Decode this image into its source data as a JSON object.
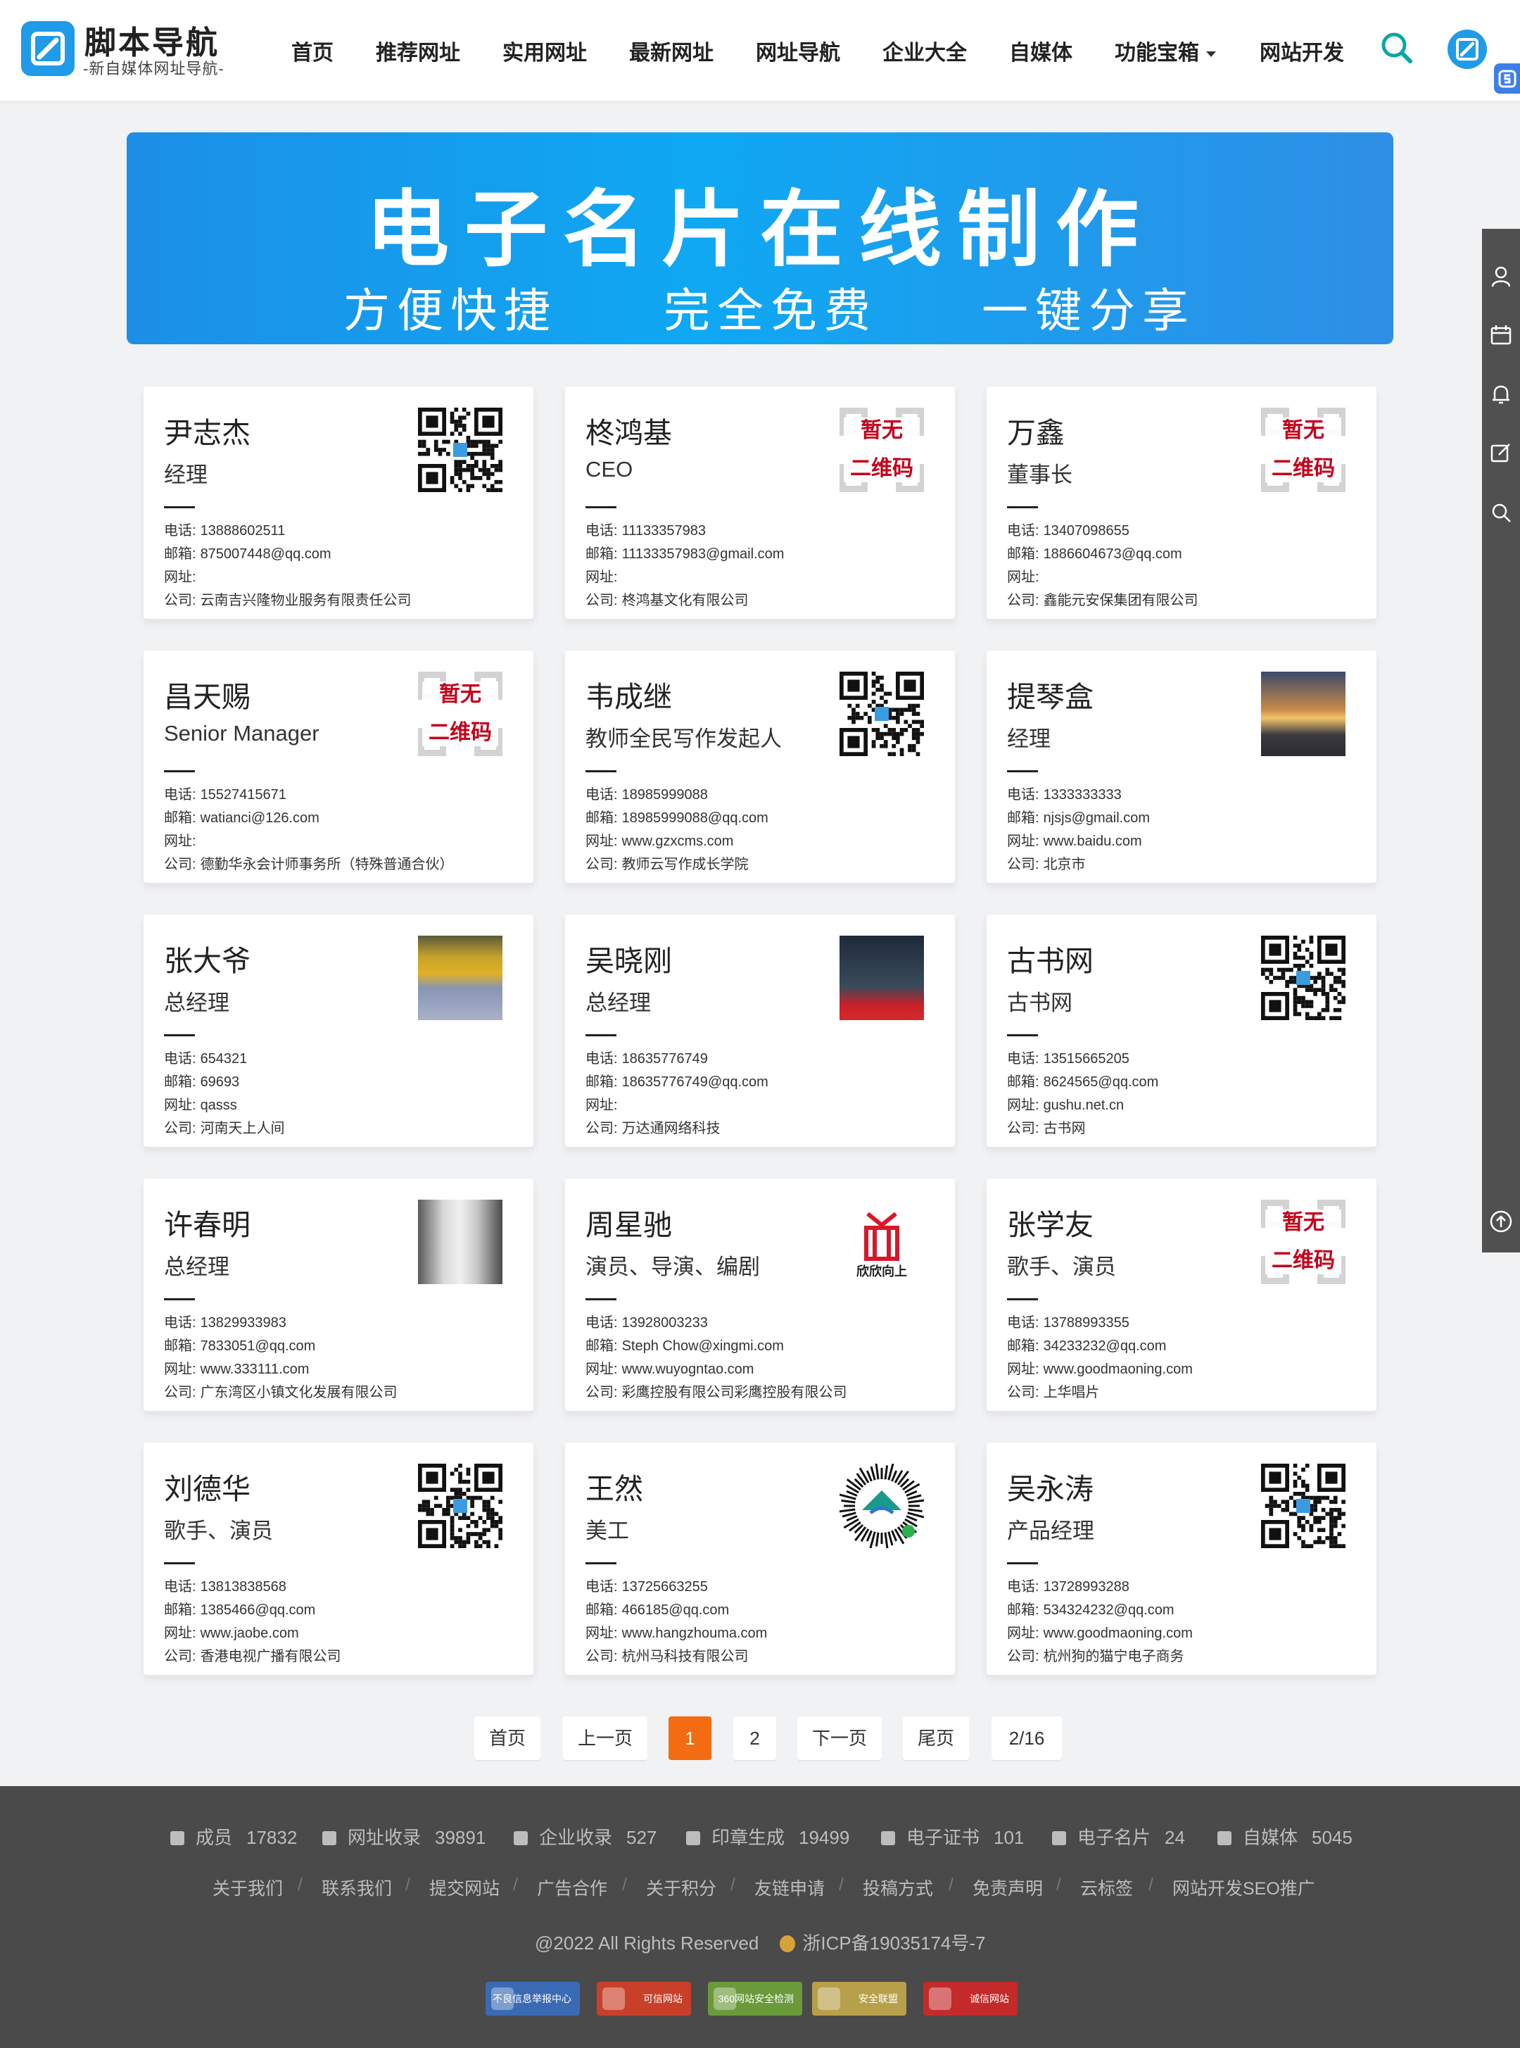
{
  "header": {
    "logo_title": "脚本导航",
    "logo_subtitle": "-新自媒体网址导航-",
    "nav": [
      "首页",
      "推荐网址",
      "实用网址",
      "最新网址",
      "网址导航",
      "企业大全",
      "自媒体",
      "功能宝箱",
      "网站开发"
    ]
  },
  "banner": {
    "title": "电子名片在线制作",
    "subtitles": [
      "方便快捷",
      "完全免费",
      "一键分享"
    ]
  },
  "labels": {
    "phone": "电话:",
    "email": "邮箱:",
    "website": "网址:",
    "company": "公司:"
  },
  "no_qr_text": [
    "暂无",
    "二维码"
  ],
  "cards": [
    {
      "name": "尹志杰",
      "title": "经理",
      "phone": "13888602511",
      "email": "875007448@qq.com",
      "website": "",
      "company": "云南吉兴隆物业服务有限责任公司",
      "image": "qr-code"
    },
    {
      "name": "柊鸿基",
      "title": "CEO",
      "phone": "11133357983",
      "email": "11133357983@gmail.com",
      "website": "",
      "company": "柊鸿基文化有限公司",
      "image": "no-qr"
    },
    {
      "name": "万鑫",
      "title": "董事长",
      "phone": "13407098655",
      "email": "1886604673@qq.com",
      "website": "",
      "company": "鑫能元安保集团有限公司",
      "image": "no-qr"
    },
    {
      "name": "昌天赐",
      "title": "Senior Manager",
      "phone": "15527415671",
      "email": "watianci@126.com",
      "website": "",
      "company": "德勤华永会计师事务所（特殊普通合伙）",
      "image": "no-qr"
    },
    {
      "name": "韦成继",
      "title": "教师全民写作发起人",
      "phone": "18985999088",
      "email": "18985999088@qq.com",
      "website": "www.gzxcms.com",
      "company": "教师云写作成长学院",
      "image": "qr-code"
    },
    {
      "name": "提琴盒",
      "title": "经理",
      "phone": "1333333333",
      "email": "njsjs@gmail.com",
      "website": "www.baidu.com",
      "company": "北京市",
      "image": "photo-sunset"
    },
    {
      "name": "张大爷",
      "title": "总经理",
      "phone": "654321",
      "email": "69693",
      "website": "qasss",
      "company": "河南天上人间",
      "image": "photo-flowers"
    },
    {
      "name": "吴晓刚",
      "title": "总经理",
      "phone": "18635776749",
      "email": "18635776749@qq.com",
      "website": "",
      "company": "万达通网络科技",
      "image": "photo-portrait"
    },
    {
      "name": "古书网",
      "title": "古书网",
      "phone": "13515665205",
      "email": "8624565@qq.com",
      "website": "gushu.net.cn",
      "company": "古书网",
      "image": "qr-code"
    },
    {
      "name": "许春明",
      "title": "总经理",
      "phone": "13829933983",
      "email": "7833051@qq.com",
      "website": "www.333111.com",
      "company": "广东湾区小镇文化发展有限公司",
      "image": "photo-interior"
    },
    {
      "name": "周星驰",
      "title": "演员、导演、编剧",
      "phone": "13928003233",
      "email": "Steph Chow@xingmi.com",
      "website": "www.wuyogntao.com",
      "company": "彩鹰控股有限公司彩鹰控股有限公司",
      "image": "logo-xinxin",
      "logo_text": "欣欣向上"
    },
    {
      "name": "张学友",
      "title": "歌手、演员",
      "phone": "13788993355",
      "email": "34233232@qq.com",
      "website": "www.goodmaoning.com",
      "company": "上华唱片",
      "image": "no-qr"
    },
    {
      "name": "刘德华",
      "title": "歌手、演员",
      "phone": "13813838568",
      "email": "1385466@qq.com",
      "website": "www.jaobe.com",
      "company": "香港电视广播有限公司",
      "image": "qr-code"
    },
    {
      "name": "王然",
      "title": "美工",
      "phone": "13725663255",
      "email": "466185@qq.com",
      "website": "www.hangzhouma.com",
      "company": "杭州马科技有限公司",
      "image": "mini-program-code"
    },
    {
      "name": "吴永涛",
      "title": "产品经理",
      "phone": "13728993288",
      "email": "534324232@qq.com",
      "website": "www.goodmaoning.com",
      "company": "杭州狗的猫宁电子商务",
      "image": "qr-code"
    }
  ],
  "pagination": {
    "first": "首页",
    "prev": "上一页",
    "pages": [
      "1",
      "2"
    ],
    "current": "1",
    "next": "下一页",
    "last": "尾页",
    "info": "2/16"
  },
  "footer": {
    "stats": [
      {
        "label": "成员",
        "value": "17832"
      },
      {
        "label": "网址收录",
        "value": "39891"
      },
      {
        "label": "企业收录",
        "value": "527"
      },
      {
        "label": "印章生成",
        "value": "19499"
      },
      {
        "label": "电子证书",
        "value": "101"
      },
      {
        "label": "电子名片",
        "value": "24"
      },
      {
        "label": "自媒体",
        "value": "5045"
      }
    ],
    "links": [
      "关于我们",
      "联系我们",
      "提交网站",
      "广告合作",
      "关于积分",
      "友链申请",
      "投稿方式",
      "免责声明",
      "云标签",
      "网站开发SEO推广"
    ],
    "copyright": "@2022 All Rights Reserved",
    "icp": "浙ICP备19035174号-7",
    "badges": [
      "不良信息举报中心",
      "可信网站",
      "360网站安全检测",
      "安全联盟",
      "诚信网站"
    ]
  },
  "colors": {
    "brand": "#1f9be8",
    "accent": "#f36c12",
    "footer_bg": "#4a4a4a",
    "no_qr_red": "#c4001a"
  }
}
